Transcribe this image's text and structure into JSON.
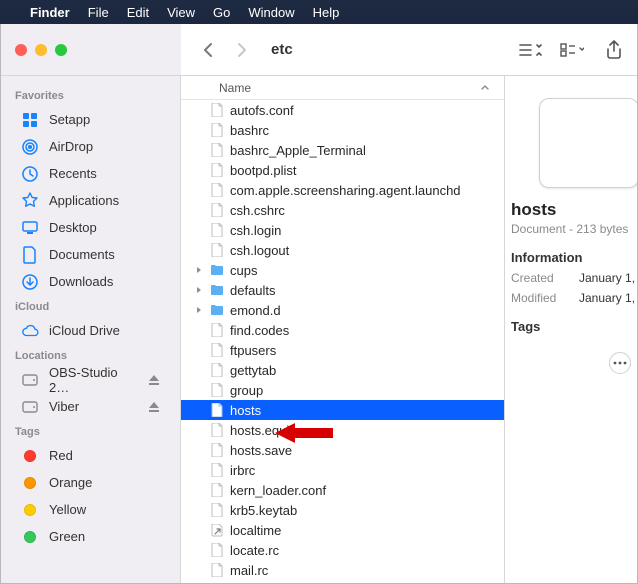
{
  "menubar": {
    "app": "Finder",
    "items": [
      "File",
      "Edit",
      "View",
      "Go",
      "Window",
      "Help"
    ]
  },
  "window": {
    "title": "etc"
  },
  "toolbar": {
    "back": "‹",
    "forward": "›"
  },
  "sidebar": {
    "sections": [
      {
        "title": "Favorites",
        "items": [
          {
            "icon": "setapp",
            "label": "Setapp"
          },
          {
            "icon": "airdrop",
            "label": "AirDrop"
          },
          {
            "icon": "recents",
            "label": "Recents"
          },
          {
            "icon": "apps",
            "label": "Applications"
          },
          {
            "icon": "desktop",
            "label": "Desktop"
          },
          {
            "icon": "docs",
            "label": "Documents"
          },
          {
            "icon": "downloads",
            "label": "Downloads"
          }
        ]
      },
      {
        "title": "iCloud",
        "items": [
          {
            "icon": "cloud",
            "label": "iCloud Drive"
          }
        ]
      },
      {
        "title": "Locations",
        "items": [
          {
            "icon": "disk",
            "label": "OBS-Studio 2…",
            "eject": true
          },
          {
            "icon": "disk",
            "label": "Viber",
            "eject": true
          }
        ]
      },
      {
        "title": "Tags",
        "items": [
          {
            "color": "#ff3b30",
            "label": "Red"
          },
          {
            "color": "#ff9500",
            "label": "Orange"
          },
          {
            "color": "#ffcc00",
            "label": "Yellow"
          },
          {
            "color": "#34c759",
            "label": "Green"
          }
        ]
      }
    ]
  },
  "listHeader": "Name",
  "files": [
    {
      "name": "autofs.conf",
      "type": "file"
    },
    {
      "name": "bashrc",
      "type": "file"
    },
    {
      "name": "bashrc_Apple_Terminal",
      "type": "file"
    },
    {
      "name": "bootpd.plist",
      "type": "file"
    },
    {
      "name": "com.apple.screensharing.agent.launchd",
      "type": "file"
    },
    {
      "name": "csh.cshrc",
      "type": "file"
    },
    {
      "name": "csh.login",
      "type": "file"
    },
    {
      "name": "csh.logout",
      "type": "file"
    },
    {
      "name": "cups",
      "type": "folder",
      "disclosure": true
    },
    {
      "name": "defaults",
      "type": "folder",
      "disclosure": true
    },
    {
      "name": "emond.d",
      "type": "folder",
      "disclosure": true
    },
    {
      "name": "find.codes",
      "type": "file"
    },
    {
      "name": "ftpusers",
      "type": "file"
    },
    {
      "name": "gettytab",
      "type": "file"
    },
    {
      "name": "group",
      "type": "file"
    },
    {
      "name": "hosts",
      "type": "file",
      "selected": true
    },
    {
      "name": "hosts.equiv",
      "type": "file"
    },
    {
      "name": "hosts.save",
      "type": "file"
    },
    {
      "name": "irbrc",
      "type": "file"
    },
    {
      "name": "kern_loader.conf",
      "type": "file"
    },
    {
      "name": "krb5.keytab",
      "type": "file"
    },
    {
      "name": "localtime",
      "type": "link"
    },
    {
      "name": "locate.rc",
      "type": "file"
    },
    {
      "name": "mail.rc",
      "type": "file"
    }
  ],
  "preview": {
    "name": "hosts",
    "meta": "Document - 213 bytes",
    "infoTitle": "Information",
    "created": {
      "k": "Created",
      "v": "January 1,"
    },
    "modified": {
      "k": "Modified",
      "v": "January 1,"
    },
    "tagsTitle": "Tags"
  }
}
